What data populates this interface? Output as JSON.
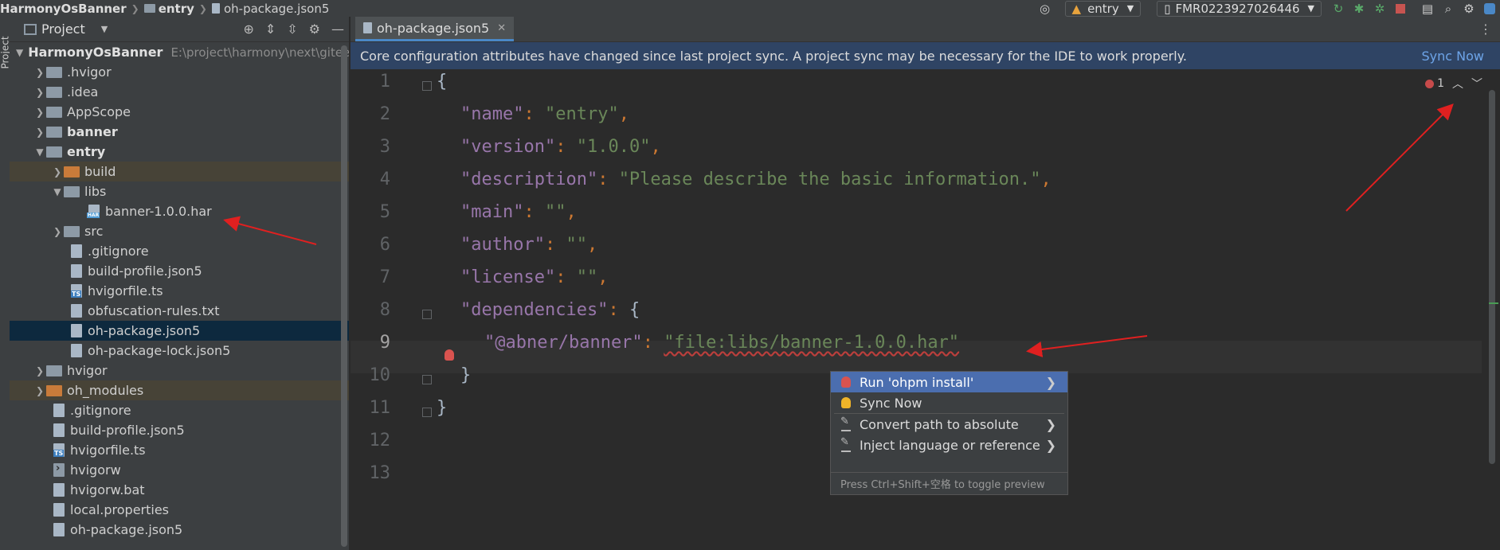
{
  "breadcrumb": [
    "HarmonyOsBanner",
    "entry",
    "oh-package.json5"
  ],
  "toolbar": {
    "module_combo": "entry",
    "device_combo": "FMR0223927026446"
  },
  "stripe_label": "Project",
  "project": {
    "title": "Project",
    "root_name": "HarmonyOsBanner",
    "root_path": "E:\\project\\harmony\\next\\gitee",
    "items": [
      {
        "label": ".hvigor"
      },
      {
        "label": ".idea"
      },
      {
        "label": "AppScope"
      },
      {
        "label": "banner"
      },
      {
        "label": "entry"
      },
      {
        "label": "build"
      },
      {
        "label": "libs"
      },
      {
        "label": "banner-1.0.0.har"
      },
      {
        "label": "src"
      },
      {
        "label": ".gitignore"
      },
      {
        "label": "build-profile.json5"
      },
      {
        "label": "hvigorfile.ts"
      },
      {
        "label": "obfuscation-rules.txt"
      },
      {
        "label": "oh-package.json5"
      },
      {
        "label": "oh-package-lock.json5"
      },
      {
        "label": "hvigor"
      },
      {
        "label": "oh_modules"
      },
      {
        "label": ".gitignore"
      },
      {
        "label": "build-profile.json5"
      },
      {
        "label": "hvigorfile.ts"
      },
      {
        "label": "hvigorw"
      },
      {
        "label": "hvigorw.bat"
      },
      {
        "label": "local.properties"
      },
      {
        "label": "oh-package.json5"
      }
    ]
  },
  "editor": {
    "tab_label": "oh-package.json5",
    "banner_text": "Core configuration attributes have changed since last project sync. A project sync may be necessary for the IDE to work properly.",
    "banner_action": "Sync Now",
    "error_count": "1",
    "line_numbers": [
      "1",
      "2",
      "3",
      "4",
      "5",
      "6",
      "7",
      "8",
      "9",
      "10",
      "11",
      "12",
      "13"
    ],
    "code": {
      "l1": "{",
      "name_key": "\"name\"",
      "name_val": "\"entry\"",
      "version_key": "\"version\"",
      "version_val": "\"1.0.0\"",
      "desc_key": "\"description\"",
      "desc_val": "\"Please describe the basic information.\"",
      "main_key": "\"main\"",
      "main_val": "\"\"",
      "author_key": "\"author\"",
      "author_val": "\"\"",
      "license_key": "\"license\"",
      "license_val": "\"\"",
      "deps_key": "\"dependencies\"",
      "dep_key": "\"@abner/banner\"",
      "dep_val": "\"file:libs/banner-1.0.0.har\"",
      "l10": "}",
      "l11": "}"
    }
  },
  "popup": {
    "items": [
      "Run 'ohpm install'",
      "Sync Now",
      "Convert path to absolute",
      "Inject language or reference"
    ],
    "footer": "Press Ctrl+Shift+空格 to toggle preview"
  },
  "colors": {
    "accent": "#4b6eaf",
    "banner_bg": "#2f4464",
    "annotation_arrow": "#e02020"
  }
}
